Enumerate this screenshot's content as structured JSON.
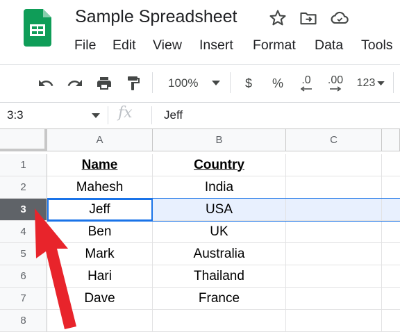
{
  "app": {
    "title": "Sample Spreadsheet",
    "icons": [
      "sheets-logo-icon",
      "star-icon",
      "move-folder-icon",
      "cloud-status-icon"
    ]
  },
  "menu": [
    "File",
    "Edit",
    "View",
    "Insert",
    "Format",
    "Data",
    "Tools"
  ],
  "toolbar": {
    "zoom": "100%",
    "currency": "$",
    "percent": "%",
    "decrease_decimal": ".0",
    "increase_decimal": ".00",
    "more_formats": "123"
  },
  "namebox": {
    "value": "3:3"
  },
  "formula": {
    "fx": "fx",
    "value": "Jeff"
  },
  "grid": {
    "columns": [
      "A",
      "B",
      "C"
    ],
    "rows": [
      "1",
      "2",
      "3",
      "4",
      "5",
      "6",
      "7",
      "8"
    ],
    "data": [
      [
        "Name",
        "Country"
      ],
      [
        "Mahesh",
        "India"
      ],
      [
        "Jeff",
        "USA"
      ],
      [
        "Ben",
        "UK"
      ],
      [
        "Mark",
        "Australia"
      ],
      [
        "Hari",
        "Thailand"
      ],
      [
        "Dave",
        "France"
      ],
      [
        "",
        ""
      ]
    ],
    "selected_row": "3",
    "active_cell": "A3"
  },
  "colors": {
    "selection_blue": "#1a73e8",
    "row_highlight": "#e8f0fe",
    "selected_header": "#5f6368",
    "arrow": "#e8242b",
    "sheets_green": "#0f9d58"
  }
}
